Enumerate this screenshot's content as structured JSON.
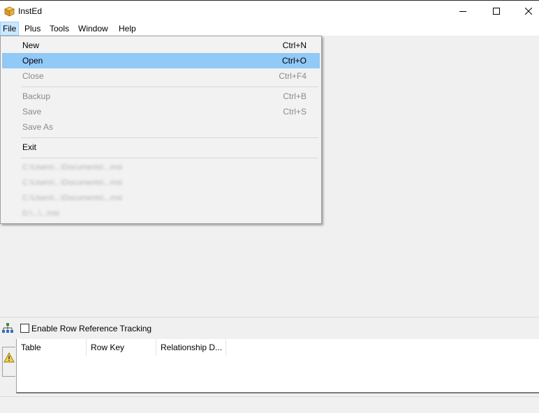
{
  "app": {
    "title": "InstEd"
  },
  "window_controls": {
    "minimize": "minimize-icon",
    "maximize": "maximize-icon",
    "close": "close-icon"
  },
  "menubar": {
    "items": [
      "File",
      "Plus",
      "Tools",
      "Window",
      "Help"
    ],
    "active": "File"
  },
  "file_menu": {
    "items": [
      {
        "label": "New",
        "shortcut": "Ctrl+N",
        "enabled": true
      },
      {
        "label": "Open",
        "shortcut": "Ctrl+O",
        "enabled": true,
        "highlighted": true
      },
      {
        "label": "Close",
        "shortcut": "Ctrl+F4",
        "enabled": false
      },
      {
        "label": "Backup",
        "shortcut": "Ctrl+B",
        "enabled": false
      },
      {
        "label": "Save",
        "shortcut": "Ctrl+S",
        "enabled": false
      },
      {
        "label": "Save As",
        "shortcut": "",
        "enabled": false
      },
      {
        "label": "Exit",
        "shortcut": "",
        "enabled": true
      }
    ],
    "recent_files_blurred": [
      "C:\\Users\\...\\Documents\\...msi",
      "C:\\Users\\...\\Documents\\...msi",
      "C:\\Users\\...\\Documents\\...msi",
      "D:\\...\\...msi"
    ]
  },
  "bottom_panel": {
    "checkbox_label": "Enable Row Reference Tracking",
    "checkbox_checked": false,
    "columns": [
      "Table",
      "Row Key",
      "Relationship D..."
    ]
  },
  "colors": {
    "highlight": "#91c9f7",
    "menu_active": "#cce8ff",
    "background": "#f0f0f0"
  }
}
